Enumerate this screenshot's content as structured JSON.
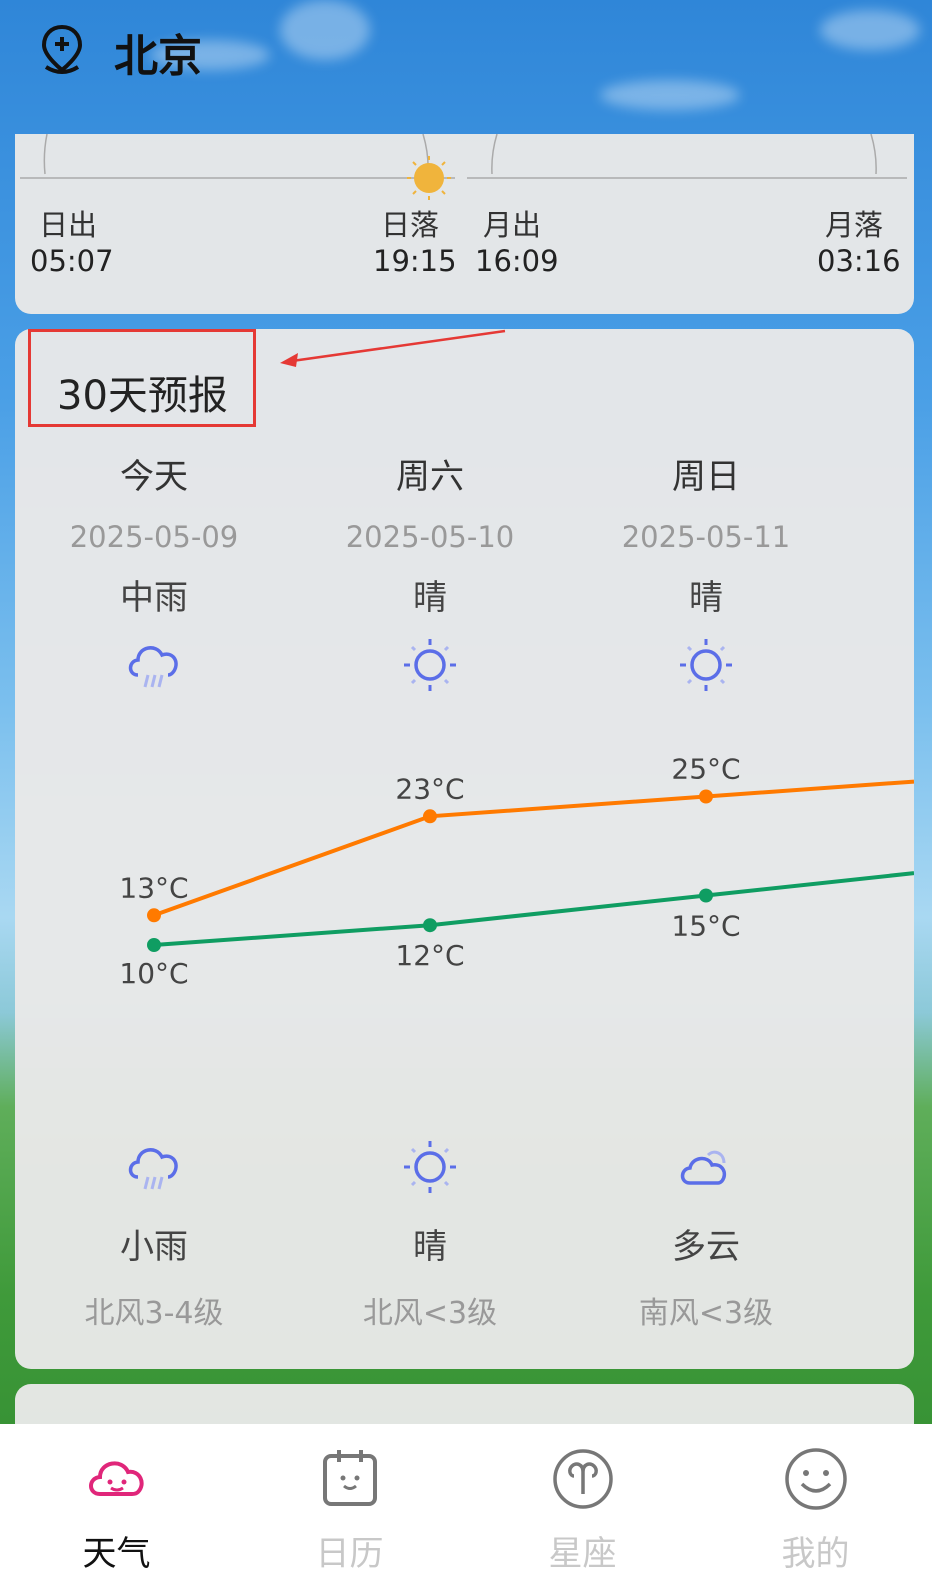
{
  "header": {
    "city": "北京"
  },
  "sun": {
    "sunrise_label": "日出",
    "sunrise_time": "05:07",
    "sunset_label": "日落",
    "sunset_time": "19:15",
    "moonrise_label": "月出",
    "moonrise_time": "16:09",
    "moonset_label": "月落",
    "moonset_time": "03:16"
  },
  "forecast": {
    "title": "30天预报",
    "days": [
      {
        "day": "今天",
        "date": "2025-05-09",
        "day_cond": "中雨",
        "day_icon": "heavy-rain-icon",
        "high": "13°C",
        "low": "10°C",
        "night_icon": "rain-icon",
        "night_cond": "小雨",
        "wind": "北风3-4级"
      },
      {
        "day": "周六",
        "date": "2025-05-10",
        "day_cond": "晴",
        "day_icon": "sun-icon",
        "high": "23°C",
        "low": "12°C",
        "night_icon": "sun-icon",
        "night_cond": "晴",
        "wind": "北风<3级"
      },
      {
        "day": "周日",
        "date": "2025-05-11",
        "day_cond": "晴",
        "day_icon": "sun-icon",
        "high": "25°C",
        "low": "15°C",
        "night_icon": "cloud-icon",
        "night_cond": "多云",
        "wind": "南风<3级"
      }
    ],
    "colors": {
      "high": "#ff7a00",
      "low": "#0f9d62",
      "icon": "#5b6ee8"
    }
  },
  "tabs": [
    {
      "label": "天气",
      "icon": "cloud-smile-icon",
      "active": true
    },
    {
      "label": "日历",
      "icon": "calendar-icon",
      "active": false
    },
    {
      "label": "星座",
      "icon": "aries-icon",
      "active": false
    },
    {
      "label": "我的",
      "icon": "smiley-icon",
      "active": false
    }
  ],
  "accent": "#e0267a"
}
